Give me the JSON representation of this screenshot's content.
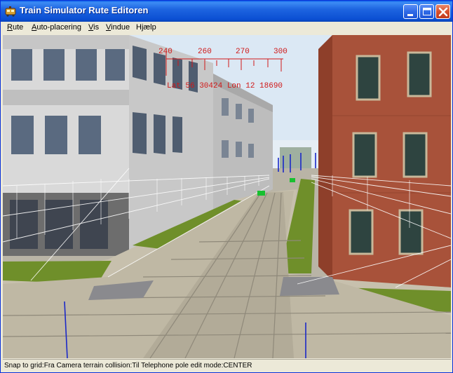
{
  "window": {
    "title": "Train Simulator Rute Editoren"
  },
  "menu": [
    {
      "label": "Rute",
      "mnemonic": "R"
    },
    {
      "label": "Auto-placering",
      "mnemonic": "A"
    },
    {
      "label": "Vis",
      "mnemonic": "V"
    },
    {
      "label": "Vindue",
      "mnemonic": "V"
    },
    {
      "label": "Hjælp",
      "mnemonic": "j"
    }
  ],
  "viewport": {
    "compass_ticks": [
      "240",
      "260",
      "270",
      "300"
    ],
    "position_readout": "Lat 56 30424 Lon 12 18690"
  },
  "status": {
    "text": "Snap to grid:Fra Camera terrain collision:Til Telephone pole edit mode:CENTER"
  },
  "colors": {
    "titlebar": "#0b4fd3",
    "hud": "#d01818",
    "grass": "#6f8f2a",
    "brick": "#a8523a"
  },
  "icons": {
    "app": "train-icon",
    "minimize": "minimize-icon",
    "maximize": "maximize-icon",
    "close": "close-icon"
  }
}
